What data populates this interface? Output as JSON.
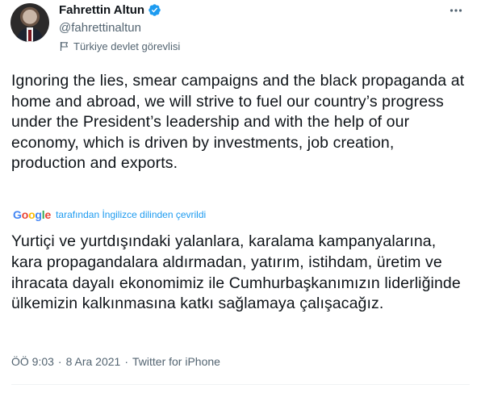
{
  "author": {
    "display_name": "Fahrettin Altun",
    "handle": "@fahrettinaltun",
    "label": "Türkiye devlet görevlisi",
    "verified": true
  },
  "tweet": {
    "text": "Ignoring the lies, smear campaigns and the black propaganda at home and abroad, we will strive to fuel our country’s progress under the President’s leadership and with the help of our economy, which is driven by investments, job creation, production and exports.",
    "translation_note": "tarafından İngilizce dilinden çevrildi",
    "translation_provider": "Google",
    "translated_text": "Yurtiçi ve yurtdışındaki yalanlara, karalama kampanyalarına, kara propagandalara aldırmadan, yatırım, istihdam, üretim ve ihracata dayalı ekonomimiz ile Cumhurbaşkanımızın liderliğinde ülkemizin kalkınmasına katkı sağlamaya çalışacağız."
  },
  "meta": {
    "time": "ÖÖ 9:03",
    "separator": "·",
    "date": "8 Ara 2021",
    "source": "Twitter for iPhone"
  },
  "icons": {
    "verified": "verified-badge-icon",
    "label": "government-flag-icon",
    "more": "more-options-icon"
  },
  "colors": {
    "verified": "#1d9bf0",
    "link": "#1d9bf0",
    "secondary_text": "#536471",
    "primary_text": "#0f1419"
  }
}
